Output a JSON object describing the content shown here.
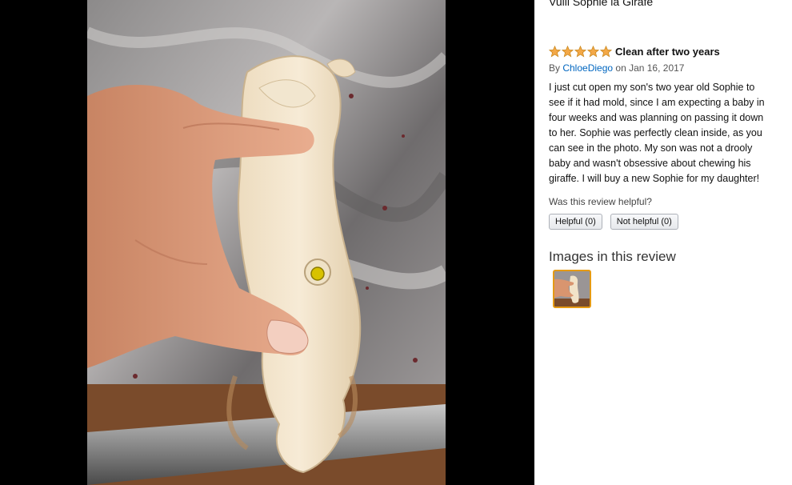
{
  "viewer": {
    "photo_icon": "review-photo-image"
  },
  "panel": {
    "product_title": "Vulli Sophie la Girafe",
    "review": {
      "rating": 5,
      "rating_max": 5,
      "star_color": "#f3a847",
      "title": "Clean after two years",
      "by_prefix": "By ",
      "author": "ChloeDiego",
      "date_text": " on Jan 16, 2017",
      "body_lines": [
        "I just cut open my son's two year old Sophie to",
        "see if it had mold, since I am expecting a baby in",
        "four weeks and was planning on passing it down",
        "to her. Sophie was perfectly clean inside, as you",
        "can see in the photo. My son was not a drooly",
        "baby and wasn't obsessive about chewing his",
        "giraffe. I will buy a new Sophie for my daughter!"
      ]
    },
    "helpful": {
      "question": "Was this review helpful?",
      "helpful_label": "Helpful (0)",
      "not_helpful_label": "Not helpful (0)"
    },
    "images": {
      "heading": "Images in this review",
      "thumb_border_color": "#e59a14"
    }
  },
  "colors": {
    "viewer_background": "#000000",
    "link": "#0066c0"
  }
}
